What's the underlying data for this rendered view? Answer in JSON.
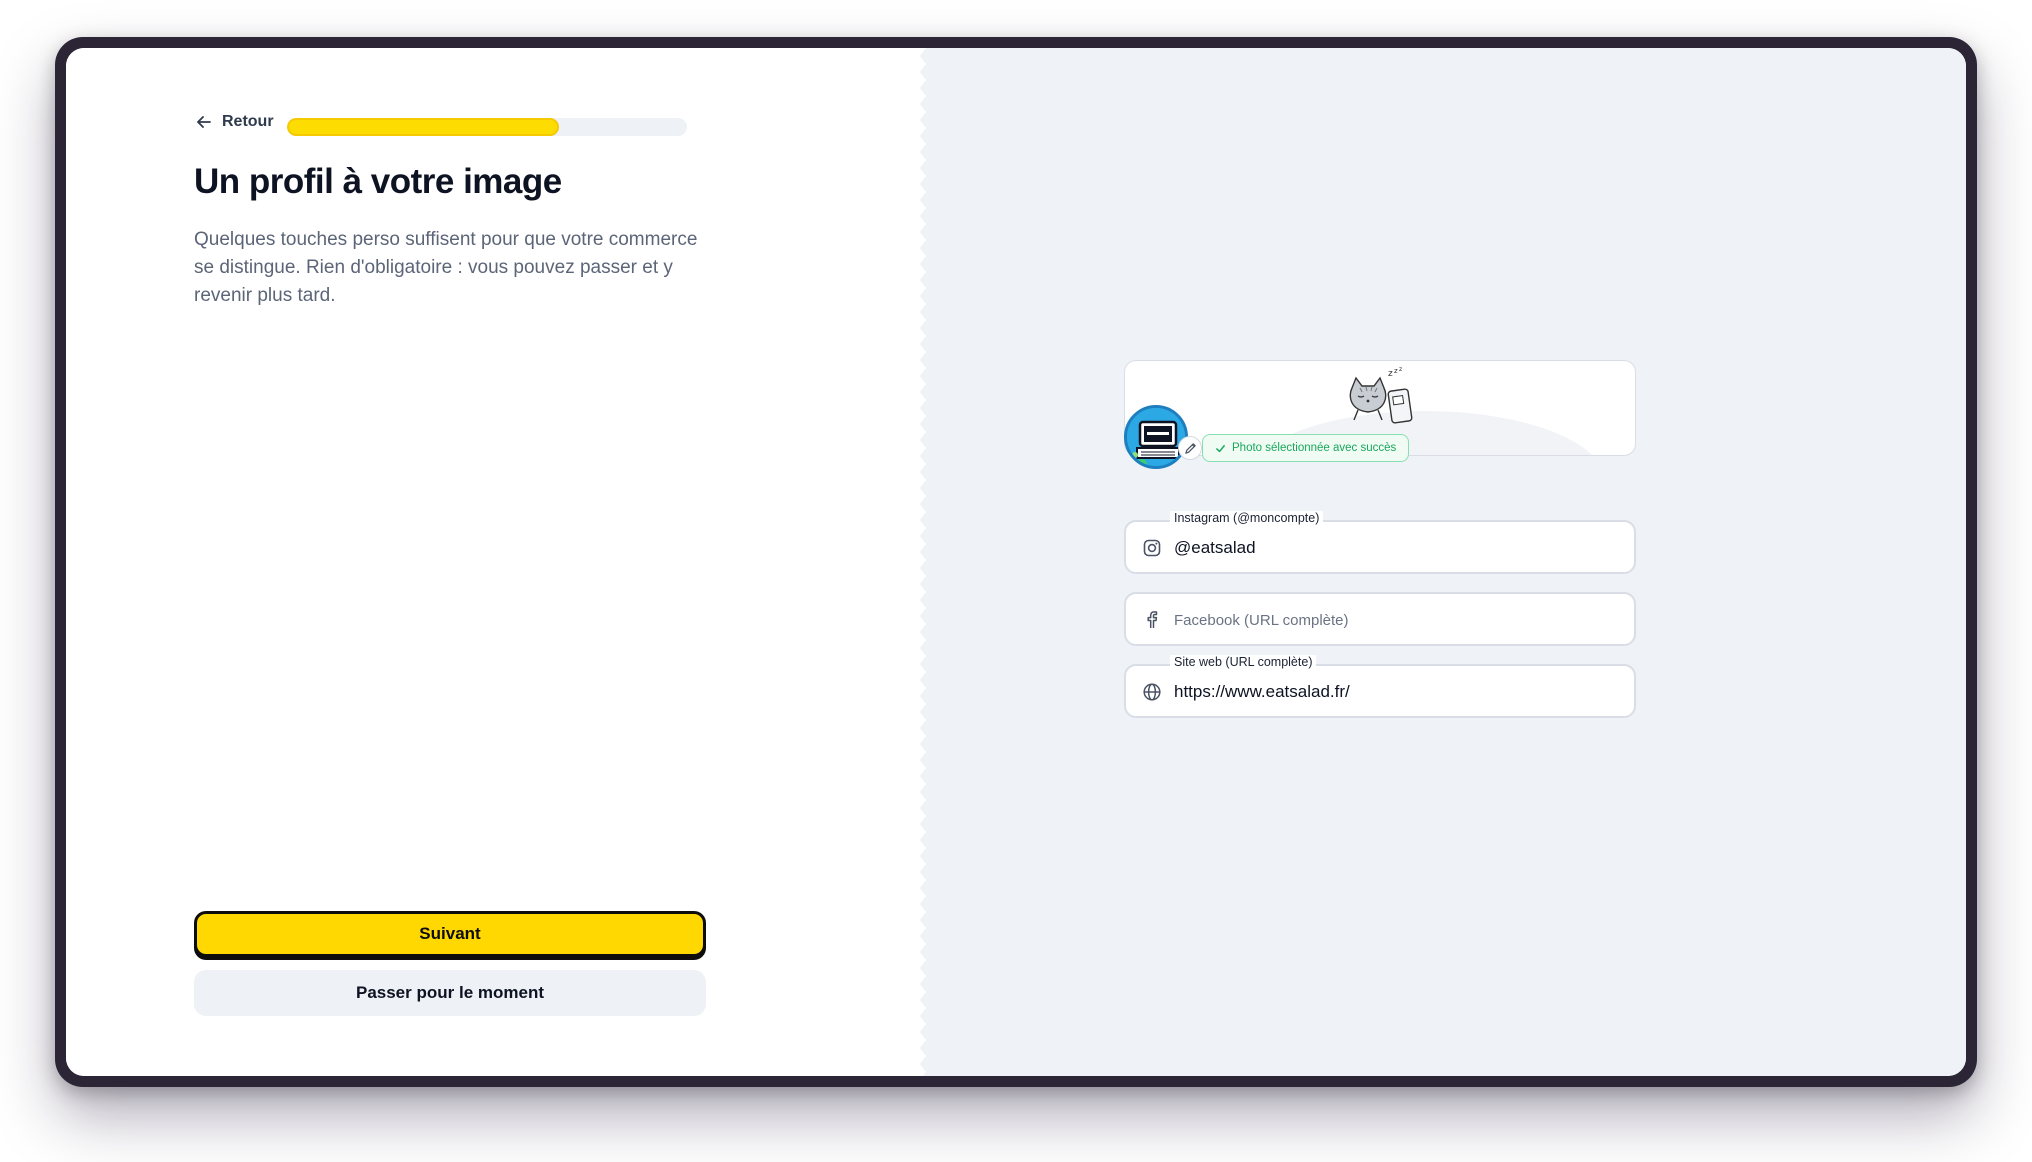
{
  "nav": {
    "back_label": "Retour",
    "progress_percent": 68
  },
  "page": {
    "title": "Un profil à votre image",
    "description": "Quelques touches perso suffisent pour que votre commerce se distingue. Rien d'obligatoire : vous pouvez passer et y revenir plus tard."
  },
  "actions": {
    "next_label": "Suivant",
    "skip_label": "Passer pour le moment"
  },
  "profile": {
    "photo_status": "Photo sélectionnée avec succès",
    "fields": {
      "instagram": {
        "label": "Instagram (@moncompte)",
        "value": "@eatsalad",
        "placeholder": "Instagram (@moncompte)"
      },
      "facebook": {
        "label": "",
        "value": "",
        "placeholder": "Facebook (URL complète)"
      },
      "website": {
        "label": "Site web (URL complète)",
        "value": "https://www.eatsalad.fr/",
        "placeholder": "Site web (URL complète)"
      }
    }
  },
  "colors": {
    "accent": "#fed800",
    "success": "#19a85c",
    "right_pane_bg": "#eff3f7"
  },
  "icons": [
    "arrow-left-icon",
    "pencil-icon",
    "check-icon",
    "instagram-icon",
    "facebook-icon",
    "globe-icon"
  ]
}
